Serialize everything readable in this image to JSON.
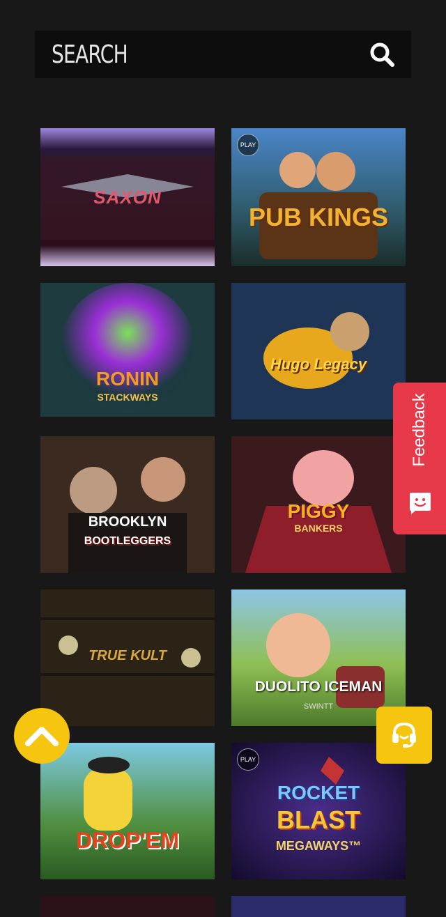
{
  "search": {
    "placeholder": "SEARCH",
    "icon": "search-icon"
  },
  "games": [
    {
      "name": "Saxon",
      "title": "SAXON",
      "badge": ""
    },
    {
      "name": "Pub Kings",
      "title": "PUB KINGS",
      "badge": "PLAY"
    },
    {
      "name": "Ronin Stackways",
      "title": "RONIN",
      "subtitle": "STACKWAYS",
      "badge": ""
    },
    {
      "name": "Hugo Legacy",
      "title": "Hugo Legacy",
      "badge": ""
    },
    {
      "name": "Brooklyn Bootleggers",
      "title": "BROOKLYN",
      "subtitle": "BOOTLEGGERS",
      "badge": ""
    },
    {
      "name": "Piggy Bankers",
      "title": "PIGGY",
      "subtitle": "BANKERS",
      "badge": ""
    },
    {
      "name": "True Kult",
      "title": "TRUE KULT",
      "badge": ""
    },
    {
      "name": "Duolito Iceman",
      "title": "DUOLITO ICEMAN",
      "subtitle": "SWINTT",
      "badge": ""
    },
    {
      "name": "Drop'Em",
      "title": "DROP'EM",
      "badge": ""
    },
    {
      "name": "Rocket Blast Megaways",
      "title": "ROCKET",
      "subtitle": "BLAST",
      "subtitle2": "MEGAWAYS™",
      "badge": "PLAY"
    }
  ],
  "feedback": {
    "label": "Feedback",
    "icon": "chat-face-icon",
    "color": "#e8394b"
  },
  "scroll_top": {
    "icon": "chevron-up-icon",
    "color": "#f5c510"
  },
  "support": {
    "icon": "headset-icon",
    "color": "#f5c510"
  }
}
